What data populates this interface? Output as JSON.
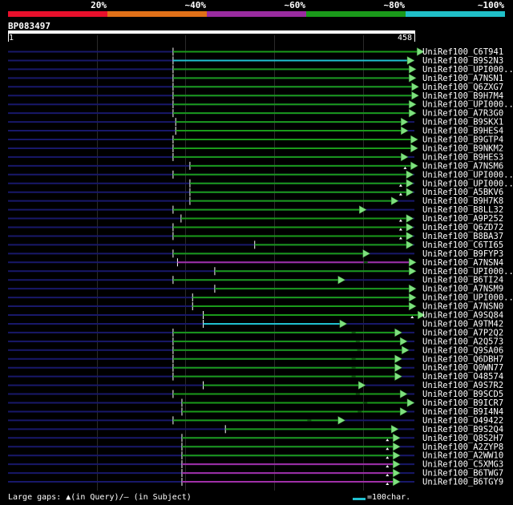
{
  "legend": {
    "segments": [
      {
        "color": "#e8102c"
      },
      {
        "color": "#e07018"
      },
      {
        "color": "#9a2ca0"
      },
      {
        "color": "#1a9a1a"
      },
      {
        "color": "#20c0c8"
      }
    ],
    "labels": [
      "20%",
      "~40%",
      "~60%",
      "~80%",
      "~100%"
    ]
  },
  "query": {
    "id": "BP083497",
    "start": "1",
    "end": "458",
    "length": 458
  },
  "colors": {
    "green": "#1a9a1a",
    "cyan": "#20c0d0",
    "purple": "#a030a8",
    "navy": "#18186a",
    "arrow_fill": "#7ee07e"
  },
  "hits": [
    {
      "label": "UniRef100_C6T941",
      "start": 186,
      "end": 469,
      "color": "green",
      "gap": null
    },
    {
      "label": "UniRef100_B9S2N3",
      "start": 186,
      "end": 458,
      "color": "cyan",
      "gap": null
    },
    {
      "label": "UniRef100_UPI000..",
      "start": 186,
      "end": 460,
      "color": "green",
      "gap": null
    },
    {
      "label": "UniRef100_A7NSN1",
      "start": 186,
      "end": 460,
      "color": "green",
      "gap": null
    },
    {
      "label": "UniRef100_Q6ZXG7",
      "start": 186,
      "end": 463,
      "color": "green",
      "gap": null
    },
    {
      "label": "UniRef100_B9H7M4",
      "start": 186,
      "end": 463,
      "color": "green",
      "gap": null
    },
    {
      "label": "UniRef100_UPI000..",
      "start": 186,
      "end": 460,
      "color": "green",
      "gap": null
    },
    {
      "label": "UniRef100_A7R3G0",
      "start": 186,
      "end": 460,
      "color": "green",
      "gap": null
    },
    {
      "label": "UniRef100_B9SKX1",
      "start": 189,
      "end": 451,
      "color": "green",
      "gap": null
    },
    {
      "label": "UniRef100_B9HES4",
      "start": 189,
      "end": 451,
      "color": "green",
      "gap": null
    },
    {
      "label": "UniRef100_B9GTP4",
      "start": 186,
      "end": 462,
      "color": "green",
      "gap": null
    },
    {
      "label": "UniRef100_B9NKM2",
      "start": 186,
      "end": 462,
      "color": "green",
      "gap": null
    },
    {
      "label": "UniRef100_B9HES3",
      "start": 186,
      "end": 451,
      "color": "green",
      "gap": null
    },
    {
      "label": "UniRef100_A7NSM6",
      "start": 205,
      "end": 462,
      "color": "green",
      "gap": "query"
    },
    {
      "label": "UniRef100_UPI000..",
      "start": 186,
      "end": 457,
      "color": "green",
      "gap": null
    },
    {
      "label": "UniRef100_UPI000..",
      "start": 205,
      "end": 457,
      "color": "green",
      "gap": "query"
    },
    {
      "label": "UniRef100_A5BKV6",
      "start": 205,
      "end": 457,
      "color": "green",
      "gap": "query"
    },
    {
      "label": "UniRef100_B9H7K8",
      "start": 205,
      "end": 440,
      "color": "green",
      "gap": null
    },
    {
      "label": "UniRef100_B8LL32",
      "start": 186,
      "end": 404,
      "color": "green",
      "gap": null
    },
    {
      "label": "UniRef100_A9P252",
      "start": 195,
      "end": 457,
      "color": "green",
      "gap": "query"
    },
    {
      "label": "UniRef100_Q6ZD72",
      "start": 186,
      "end": 457,
      "color": "green",
      "gap": "query"
    },
    {
      "label": "UniRef100_B8BA37",
      "start": 186,
      "end": 457,
      "color": "green",
      "gap": "query"
    },
    {
      "label": "UniRef100_C6TI65",
      "start": 278,
      "end": 457,
      "color": "green",
      "gap": null
    },
    {
      "label": "UniRef100_B9FYP3",
      "start": 186,
      "end": 408,
      "color": "green",
      "gap": null
    },
    {
      "label": "UniRef100_A7NSN4",
      "start": 191,
      "end": 460,
      "color": "purple",
      "gap": "subject"
    },
    {
      "label": "UniRef100_UPI000..",
      "start": 233,
      "end": 460,
      "color": "green",
      "gap": null
    },
    {
      "label": "UniRef100_B6TI24",
      "start": 186,
      "end": 380,
      "color": "green",
      "gap": null
    },
    {
      "label": "UniRef100_A7NSM9",
      "start": 233,
      "end": 460,
      "color": "green",
      "gap": null
    },
    {
      "label": "UniRef100_UPI000..",
      "start": 208,
      "end": 460,
      "color": "green",
      "gap": null
    },
    {
      "label": "UniRef100_A7NSN0",
      "start": 208,
      "end": 460,
      "color": "green",
      "gap": null
    },
    {
      "label": "UniRef100_A9SQ84",
      "start": 220,
      "end": 470,
      "color": "green",
      "gap": "query"
    },
    {
      "label": "UniRef100_A9TM42",
      "start": 220,
      "end": 382,
      "color": "cyan",
      "gap": null
    },
    {
      "label": "UniRef100_A7P2Q2",
      "start": 186,
      "end": 444,
      "color": "green",
      "gap": "subject"
    },
    {
      "label": "UniRef100_A2Q573",
      "start": 186,
      "end": 450,
      "color": "green",
      "gap": "subject"
    },
    {
      "label": "UniRef100_Q9SA06",
      "start": 186,
      "end": 452,
      "color": "green",
      "gap": "subject"
    },
    {
      "label": "UniRef100_Q6DBH7",
      "start": 186,
      "end": 444,
      "color": "green",
      "gap": "subject"
    },
    {
      "label": "UniRef100_Q0WN77",
      "start": 186,
      "end": 444,
      "color": "green",
      "gap": "subject"
    },
    {
      "label": "UniRef100_O48574",
      "start": 186,
      "end": 444,
      "color": "green",
      "gap": "subject"
    },
    {
      "label": "UniRef100_A9S7R2",
      "start": 220,
      "end": 403,
      "color": "green",
      "gap": null
    },
    {
      "label": "UniRef100_B9SCD5",
      "start": 186,
      "end": 450,
      "color": "green",
      "gap": "subject"
    },
    {
      "label": "UniRef100_B9ICR7",
      "start": 196,
      "end": 458,
      "color": "green",
      "gap": "subject"
    },
    {
      "label": "UniRef100_B9I4N4",
      "start": 196,
      "end": 450,
      "color": "green",
      "gap": "subject"
    },
    {
      "label": "UniRef100_O49422",
      "start": 186,
      "end": 380,
      "color": "green",
      "gap": "subject"
    },
    {
      "label": "UniRef100_B9S2Q4",
      "start": 245,
      "end": 440,
      "color": "green",
      "gap": null
    },
    {
      "label": "UniRef100_Q8S2H7",
      "start": 196,
      "end": 442,
      "color": "green",
      "gap": "query"
    },
    {
      "label": "UniRef100_A2ZYP8",
      "start": 196,
      "end": 442,
      "color": "green",
      "gap": "query"
    },
    {
      "label": "UniRef100_A2WW10",
      "start": 196,
      "end": 442,
      "color": "green",
      "gap": "query"
    },
    {
      "label": "UniRef100_C5XMG3",
      "start": 196,
      "end": 442,
      "color": "purple",
      "gap": "query"
    },
    {
      "label": "UniRef100_B6TWG7",
      "start": 196,
      "end": 442,
      "color": "purple",
      "gap": "query"
    },
    {
      "label": "UniRef100_B6TGY9",
      "start": 196,
      "end": 442,
      "color": "purple",
      "gap": "query"
    }
  ],
  "footer": {
    "left_prefix": "Large gaps:",
    "query_gap_symbol": "▲",
    "query_gap_text": "(in Query)/",
    "subject_gap_symbol": "–",
    "subject_gap_text": " (in Subject)",
    "scale_text": "=100char."
  }
}
